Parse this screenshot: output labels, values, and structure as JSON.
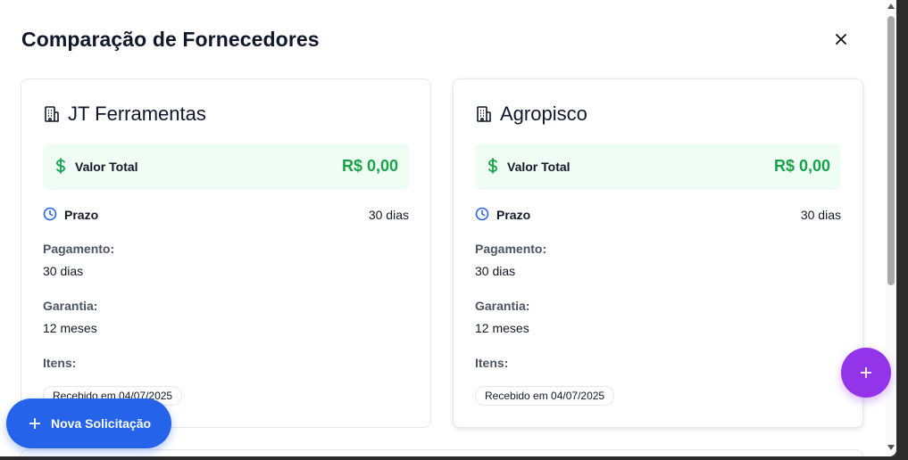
{
  "modal": {
    "title": "Comparação de Fornecedores",
    "close_icon": "close-icon"
  },
  "suppliers": [
    {
      "icon": "building-icon",
      "name": "JT Ferramentas",
      "total_label": "Valor Total",
      "total_value": "R$ 0,00",
      "prazo_label": "Prazo",
      "prazo_value": "30 dias",
      "pagamento_label": "Pagamento:",
      "pagamento_value": "30 dias",
      "garantia_label": "Garantia:",
      "garantia_value": "12 meses",
      "itens_label": "Itens:",
      "status_badge": "Recebido em 04/07/2025"
    },
    {
      "icon": "building-icon",
      "name": "Agropisco",
      "total_label": "Valor Total",
      "total_value": "R$ 0,00",
      "prazo_label": "Prazo",
      "prazo_value": "30 dias",
      "pagamento_label": "Pagamento:",
      "pagamento_value": "30 dias",
      "garantia_label": "Garantia:",
      "garantia_value": "12 meses",
      "itens_label": "Itens:",
      "status_badge": "Recebido em 04/07/2025"
    }
  ],
  "fab": {
    "nova_label": "Nova Solicitação",
    "nova_icon": "plus-icon",
    "add_icon": "plus-icon"
  },
  "colors": {
    "accent_green": "#16a34a",
    "total_bg": "#f0fdf4",
    "clock_blue": "#2563eb",
    "fab_blue": "#2563eb",
    "fab_purple": "#9333ea"
  }
}
